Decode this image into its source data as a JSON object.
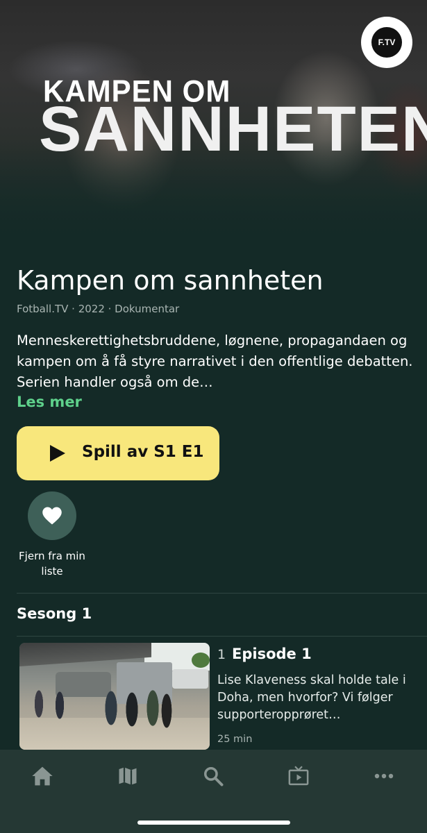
{
  "hero": {
    "title_line1": "KAMPEN OM",
    "title_line2": "SANNHETEN",
    "logo_text": "F.TV"
  },
  "series": {
    "title": "Kampen om sannheten",
    "meta": "Fotball.TV · 2022 · Dokumentar",
    "description": "Menneskerettighetsbruddene, løgnene, propagandaen og kampen om å få styre narrativet i den offentlige debatten. Serien handler også om de…",
    "read_more": "Les mer",
    "play_label": "Spill av S1 E1",
    "favorite_label": "Fjern fra min liste"
  },
  "season": {
    "title": "Sesong 1",
    "episodes": [
      {
        "number": "1",
        "title": "Episode 1",
        "description": "Lise Klaveness skal holde tale i Doha, men hvorfor? Vi følger supporteropprøret…",
        "duration": "25 min"
      }
    ]
  },
  "tabbar": {
    "items": [
      {
        "icon": "home-icon"
      },
      {
        "icon": "map-icon"
      },
      {
        "icon": "search-icon"
      },
      {
        "icon": "tv-icon"
      },
      {
        "icon": "more-icon"
      }
    ]
  },
  "colors": {
    "background": "#142a27",
    "accent_green": "#5ed08b",
    "play_button": "#f8e77c",
    "favorite_button": "#3e6058",
    "tabbar": "#253834",
    "tab_icon": "#8a9693"
  }
}
